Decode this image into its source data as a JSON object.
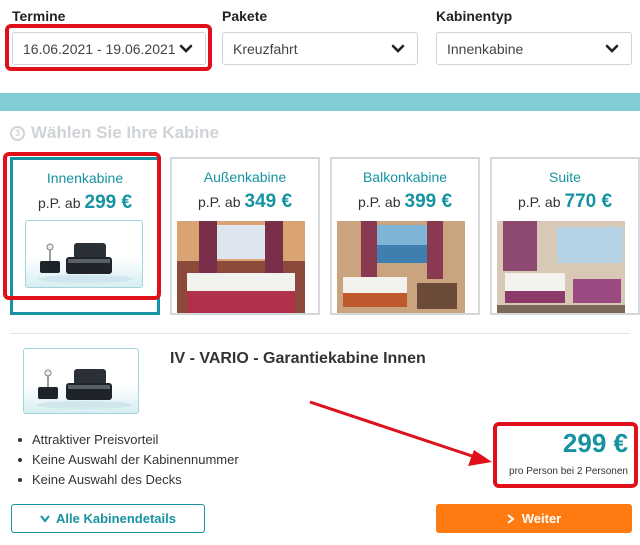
{
  "filters": {
    "termine": {
      "label": "Termine",
      "value": "16.06.2021 - 19.06.2021"
    },
    "pakete": {
      "label": "Pakete",
      "value": "Kreuzfahrt"
    },
    "kabinentyp": {
      "label": "Kabinentyp",
      "value": "Innenkabine"
    }
  },
  "step": {
    "number": "3",
    "title": "Wählen Sie Ihre Kabine"
  },
  "cabins": [
    {
      "name": "Innenkabine",
      "prefix": "p.P. ab",
      "price": "299 €",
      "selected": true
    },
    {
      "name": "Außenkabine",
      "prefix": "p.P. ab",
      "price": "349 €",
      "selected": false
    },
    {
      "name": "Balkonkabine",
      "prefix": "p.P. ab",
      "price": "399 €",
      "selected": false
    },
    {
      "name": "Suite",
      "prefix": "p.P. ab",
      "price": "770 €",
      "selected": false
    }
  ],
  "detail": {
    "title": "IV - VARIO - Garantiekabine Innen",
    "bullets": [
      "Attraktiver Preisvorteil",
      "Keine Auswahl der Kabinennummer",
      "Keine Auswahl des Decks"
    ],
    "price": "299 €",
    "price_note": "pro Person bei 2 Personen"
  },
  "buttons": {
    "details": "Alle Kabinendetails",
    "next": "Weiter"
  },
  "colors": {
    "accent": "#1593a2",
    "band": "#80cdd8",
    "highlight": "#e0101a",
    "cta": "#ff7a10"
  }
}
